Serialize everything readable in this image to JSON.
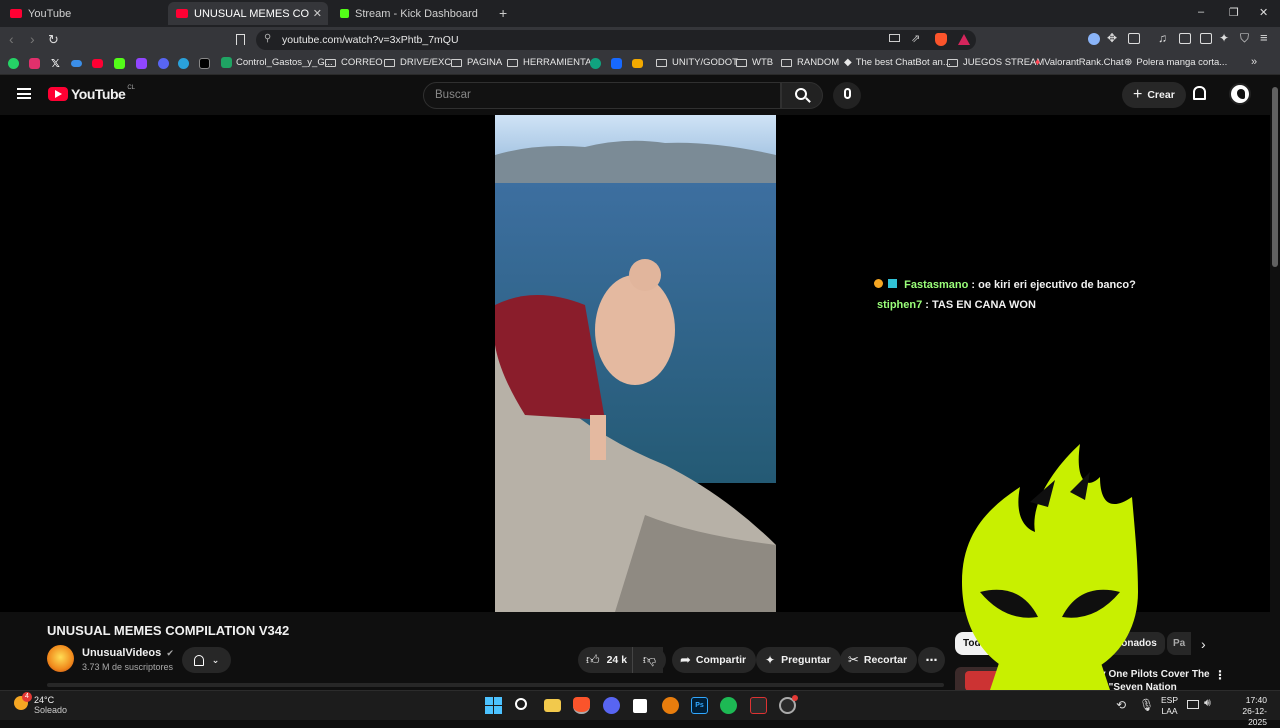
{
  "tabs": [
    {
      "title": "YouTube",
      "active": false
    },
    {
      "title": "UNUSUAL MEMES COMPILATION",
      "active": true
    },
    {
      "title": "Stream - Kick Dashboard",
      "active": false
    }
  ],
  "window_controls": {
    "minimize": "–",
    "maximize": "❐",
    "close": "✕"
  },
  "address": {
    "url": "youtube.com/watch?v=3xPhtb_7mQU"
  },
  "bookmarks": [
    "Control_Gastos_y_G...",
    "CORREO",
    "DRIVE/EXC",
    "PAGINA",
    "HERRAMIENTAS",
    "UNITY/GODOT",
    "WTB",
    "RANDOM",
    "The best ChatBot an...",
    "JUEGOS STREAM",
    "ValorantRank.Chat",
    "Polera manga corta..."
  ],
  "youtube": {
    "logo_text": "YouTube",
    "region": "CL",
    "search_placeholder": "Buscar",
    "create_label": "Crear"
  },
  "chat": [
    {
      "user": "Fastasmano",
      "message": ": oe kiri eri ejecutivo de banco?",
      "user_color": "#9bff7a"
    },
    {
      "user": "stiphen7",
      "message": ": TAS EN CANA WON",
      "user_color": "#9bff7a"
    }
  ],
  "video": {
    "title": "UNUSUAL MEMES COMPILATION V342",
    "channel": "UnusualVideos",
    "subscribers": "3.73 M de suscriptores",
    "likes": "24 k",
    "share": "Compartir",
    "ask": "Preguntar",
    "clip": "Recortar"
  },
  "filters": {
    "all": "Todos",
    "related": "elacionados",
    "more": "Pa"
  },
  "related": {
    "title_line1": "Twenty One Pilots Cover The",
    "title_line2": "Stripes \"Seven Nation"
  },
  "taskbar": {
    "temp": "24°C",
    "weather": "Soleado",
    "badge": "4",
    "lang": "ESP",
    "layout": "LAA",
    "time": "17:40",
    "date": "26-12-2025"
  },
  "colors": {
    "accent": "#ff0033",
    "overlay_logo": "#c8f000",
    "chat_user": "#9bff7a"
  }
}
